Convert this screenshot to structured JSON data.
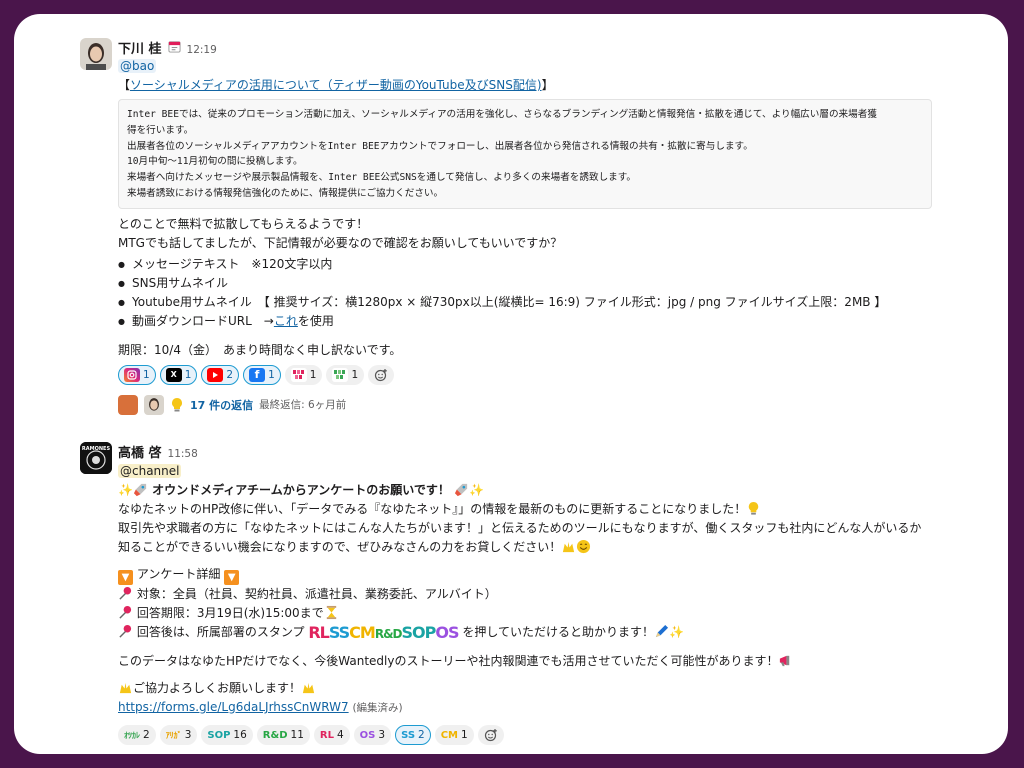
{
  "message1": {
    "author": "下川 桂",
    "status_icon": "calendar-icon",
    "time": "12:19",
    "mention": "@bao",
    "title_open": "【",
    "title_link": "ソーシャルメディアの活用について（ティザー動画のYouTube及びSNS配信)",
    "title_close": "】",
    "quote_lines": [
      "Inter BEEでは、従来のプロモーション活動に加え、ソーシャルメディアの活用を強化し、さらなるブランディング活動と情報発信・拡散を通じて、より幅広い層の来場者獲",
      "得を行います。",
      "出展者各位のソーシャルメディアアカウントをInter BEEアカウントでフォローし、出展者各位から発信される情報の共有・拡散に寄与します。",
      "10月中旬〜11月初旬の間に投稿します。",
      "来場者へ向けたメッセージや展示製品情報を、Inter BEE公式SNSを通して発信し、より多くの来場者を誘致します。",
      "来場者誘致における情報発信強化のために、情報提供にご協力ください。"
    ],
    "body_lines": [
      "とのことで無料で拡散してもらえるようです！",
      "MTGでも話してましたが、下記情報が必要なので確認をお願いしてもいいですか？"
    ],
    "bullets": [
      "メッセージテキスト　※120文字以内",
      "SNS用サムネイル",
      "Youtube用サムネイル　【 推奨サイズ：横1280px × 縦730px以上(縦横比= 16:9) ファイル形式：jpg / png ファイルサイズ上限：2MB 】"
    ],
    "bullet4_prefix": "動画ダウンロードURL　→",
    "bullet4_link": "これ",
    "bullet4_suffix": "を使用",
    "deadline": "期限：10/4（金）　あまり時間なく申し訳ないです。",
    "reactions": [
      {
        "icon": "instagram-icon",
        "count": "1",
        "active": true
      },
      {
        "icon": "x-icon",
        "label": "X",
        "count": "1",
        "active": true
      },
      {
        "icon": "youtube-icon",
        "count": "2",
        "active": true
      },
      {
        "icon": "facebook-icon",
        "label": "f",
        "count": "1",
        "active": true
      },
      {
        "icon": "pink-stamp-icon",
        "count": "1",
        "active": false
      },
      {
        "icon": "green-stamp-icon",
        "count": "1",
        "active": false
      }
    ],
    "reply_count": "17 件の返信",
    "last_reply": "最終返信: 6ヶ月前"
  },
  "message2": {
    "author": "高橋 啓",
    "time": "11:58",
    "avatar_text": "RAMONES",
    "mention": "@channel",
    "headline": "オウンドメディアチームからアンケートのお願いです！",
    "line1": "なゆたネットのHP改修に伴い、「データでみる『なゆたネット』」の情報を最新のものに更新することになりました！",
    "line2": "取引先や求職者の方に「なゆたネットにはこんな人たちがいます！」と伝えるためのツールにもなりますが、働くスタッフも社内にどんな人がいるか",
    "line3": "知ることができるいい機会になりますので、ぜひみなさんの力をお貸しください！",
    "detail_title": "アンケート詳細",
    "detail1": "対象：全員（社員、契約社員、派遣社員、業務委託、アルバイト）",
    "detail2": "回答期限：3月19日(水)15:00まで",
    "detail3_prefix": "回答後は、所属部署のスタンプ",
    "detail3_stamps": [
      "RL",
      "SS",
      "CM",
      "R&D",
      "SOP",
      "OS"
    ],
    "detail3_suffix": "を押していただけると助かります！",
    "closing": "このデータはなゆたHPだけでなく、今後Wantedlyのストーリーや社内報関連でも活用させていただく可能性があります！",
    "thanks": "ご協力よろしくお願いします！",
    "form_link": "https://forms.gle/Lg6daLJrhssCnWRW7",
    "edited": "(編集済み)",
    "reactions": [
      {
        "label": "ｵﾂｶﾚ",
        "count": "2",
        "color": "#3aa655",
        "active": false
      },
      {
        "label": "ｱﾘｶﾞ",
        "count": "3",
        "color": "#e8a200",
        "active": false
      },
      {
        "label": "SOP",
        "count": "16",
        "color": "#1aa3a3",
        "active": false
      },
      {
        "label": "R&D",
        "count": "11",
        "color": "#28a745",
        "active": false
      },
      {
        "label": "RL",
        "count": "4",
        "color": "#e0245e",
        "active": false
      },
      {
        "label": "OS",
        "count": "3",
        "color": "#9b51e0",
        "active": false
      },
      {
        "label": "SS",
        "count": "2",
        "color": "#1d9bd1",
        "active": true
      },
      {
        "label": "CM",
        "count": "1",
        "color": "#f0b400",
        "active": false
      }
    ]
  }
}
